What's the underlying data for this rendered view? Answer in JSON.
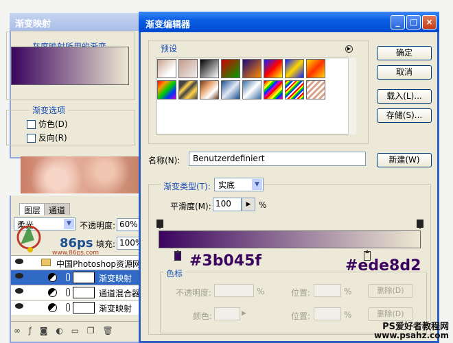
{
  "gradient_map": {
    "title": "渐变映射",
    "group_label": "灰度映射所用的渐变",
    "options_label": "渐变选项",
    "dither_label": "仿色(D)",
    "reverse_label": "反向(R)"
  },
  "layers_panel": {
    "tabs": [
      "图层",
      "通道"
    ],
    "blend_mode": "柔光",
    "opacity_label": "不透明度:",
    "opacity_value": "60%",
    "fill_label": "填充:",
    "fill_value": "100%",
    "group_name": "中国Photoshop资源网",
    "layers": [
      "渐变映射",
      "通道混合器",
      "渐变映射"
    ],
    "overlay_logo": "86ps",
    "overlay_url": "www.86ps.com"
  },
  "gradient_editor": {
    "title": "渐变编辑器",
    "presets_label": "预设",
    "buttons": {
      "ok": "确定",
      "cancel": "取消",
      "load": "载入(L)...",
      "save": "存储(S)...",
      "new": "新建(W)"
    },
    "name_label": "名称(N):",
    "name_value": "Benutzerdefiniert",
    "gradient_type_label": "渐变类型(T):",
    "gradient_type_value": "实底",
    "smoothness_label": "平滑度(M):",
    "smoothness_value": "100",
    "smoothness_unit": "%",
    "color_start": "#3b045f",
    "color_end": "#ede8d2",
    "stops": {
      "label": "色标",
      "opacity_label": "不透明度:",
      "pct": "%",
      "position_label": "位置:",
      "delete_label": "删除(D)",
      "color_label": "颜色:"
    }
  },
  "watermark": {
    "line1": "PS爱好者教程网",
    "line2": "www.psahz.com"
  },
  "colors": {
    "title_blue": "#0a5fe3",
    "dialog_bg": "#ece9d8",
    "selected_row": "#316ac5"
  }
}
